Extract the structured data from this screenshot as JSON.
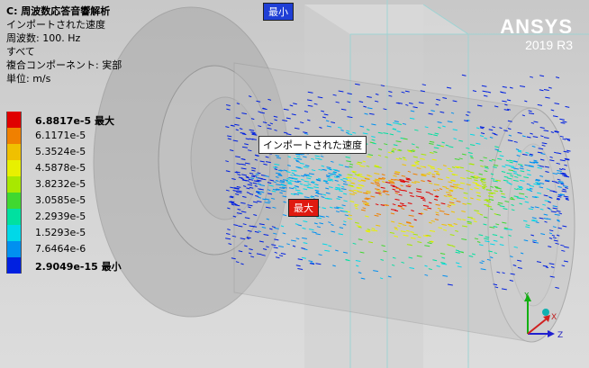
{
  "info": {
    "title": "C: 周波数応答音響解析",
    "line1": "インポートされた速度",
    "line2": "周波数: 100. Hz",
    "line3": "すべて",
    "line4": "複合コンポーネント: 実部",
    "line5": "単位: m/s"
  },
  "legend": [
    {
      "label": "6.8817e-5 最大",
      "color": "#e00000"
    },
    {
      "label": "6.1171e-5",
      "color": "#f08000"
    },
    {
      "label": "5.3524e-5",
      "color": "#f0c000"
    },
    {
      "label": "4.5878e-5",
      "color": "#e8f000"
    },
    {
      "label": "3.8232e-5",
      "color": "#a8e800"
    },
    {
      "label": "3.0585e-5",
      "color": "#40d830"
    },
    {
      "label": "2.2939e-5",
      "color": "#00e0a0"
    },
    {
      "label": "1.5293e-5",
      "color": "#00d8e8"
    },
    {
      "label": "7.6464e-6",
      "color": "#0090f0"
    },
    {
      "label": "2.9049e-15 最小",
      "color": "#0020e0"
    }
  ],
  "logo": {
    "brand": "ANSYS",
    "version": "2019 R3"
  },
  "probes": {
    "min": "最小",
    "max": "最大"
  },
  "callout": "インポートされた速度",
  "axes": {
    "x": "X",
    "y": "Y",
    "z": "Z"
  }
}
